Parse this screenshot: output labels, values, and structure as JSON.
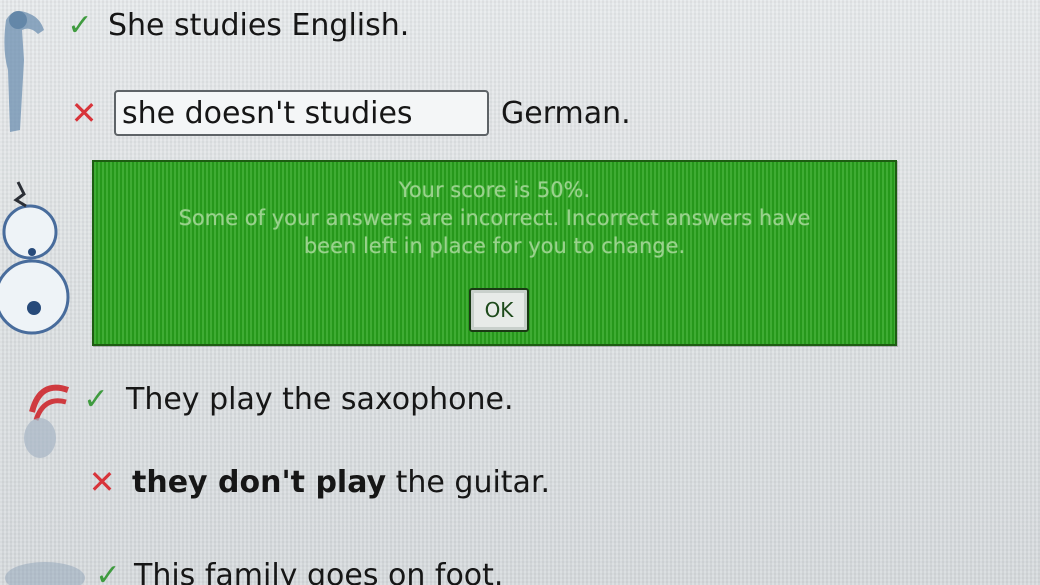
{
  "rows": [
    {
      "status": "correct",
      "text": "She studies English."
    },
    {
      "status": "incorrect",
      "input_value": "she doesn't studies",
      "suffix": "German."
    },
    {
      "status": "correct",
      "text": "They play the saxophone."
    },
    {
      "status": "incorrect",
      "bold_part": "they don't play",
      "rest": " the guitar."
    },
    {
      "status": "correct",
      "text": "This family goes on foot."
    }
  ],
  "marks": {
    "check": "✓",
    "cross": "✕"
  },
  "feedback_dialog": {
    "score_line": "Your score is 50%.",
    "message_line1": "Some of your answers are incorrect. Incorrect answers have",
    "message_line2": "been left in place for you to change.",
    "ok_label": "OK"
  },
  "colors": {
    "dialog_green": "#29a31d",
    "check_green": "#3f9b3f",
    "cross_red": "#d8343a"
  }
}
